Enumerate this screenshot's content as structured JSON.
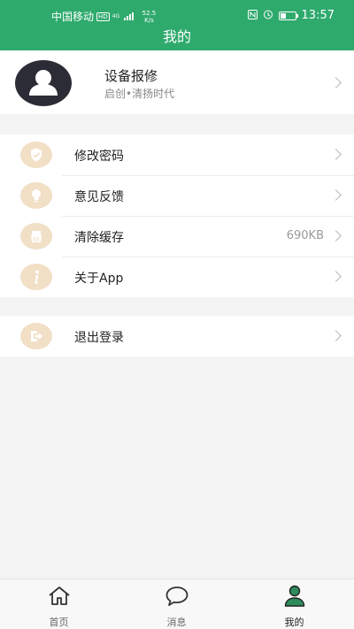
{
  "status_bar": {
    "carrier": "中国移动",
    "hd_tag": "HD",
    "network": "4G",
    "speed_value": "52.5",
    "speed_unit": "K/s",
    "time": "13:57"
  },
  "header": {
    "title": "我的"
  },
  "profile": {
    "name": "设备报修",
    "subtitle": "启创•清扬时代"
  },
  "menu": {
    "items": [
      {
        "label": "修改密码"
      },
      {
        "label": "意见反馈"
      },
      {
        "label": "清除缓存",
        "value": "690KB"
      },
      {
        "label": "关于App"
      }
    ]
  },
  "logout": {
    "label": "退出登录"
  },
  "tabbar": {
    "tabs": [
      {
        "label": "首页"
      },
      {
        "label": "消息"
      },
      {
        "label": "我的"
      }
    ]
  },
  "colors": {
    "brand": "#2faa6d",
    "icon_bg": "#f1dfc6",
    "icon_fg": "#ffffff",
    "avatar_bg": "#2c2c36",
    "active_tab": "#2e8b5c"
  }
}
